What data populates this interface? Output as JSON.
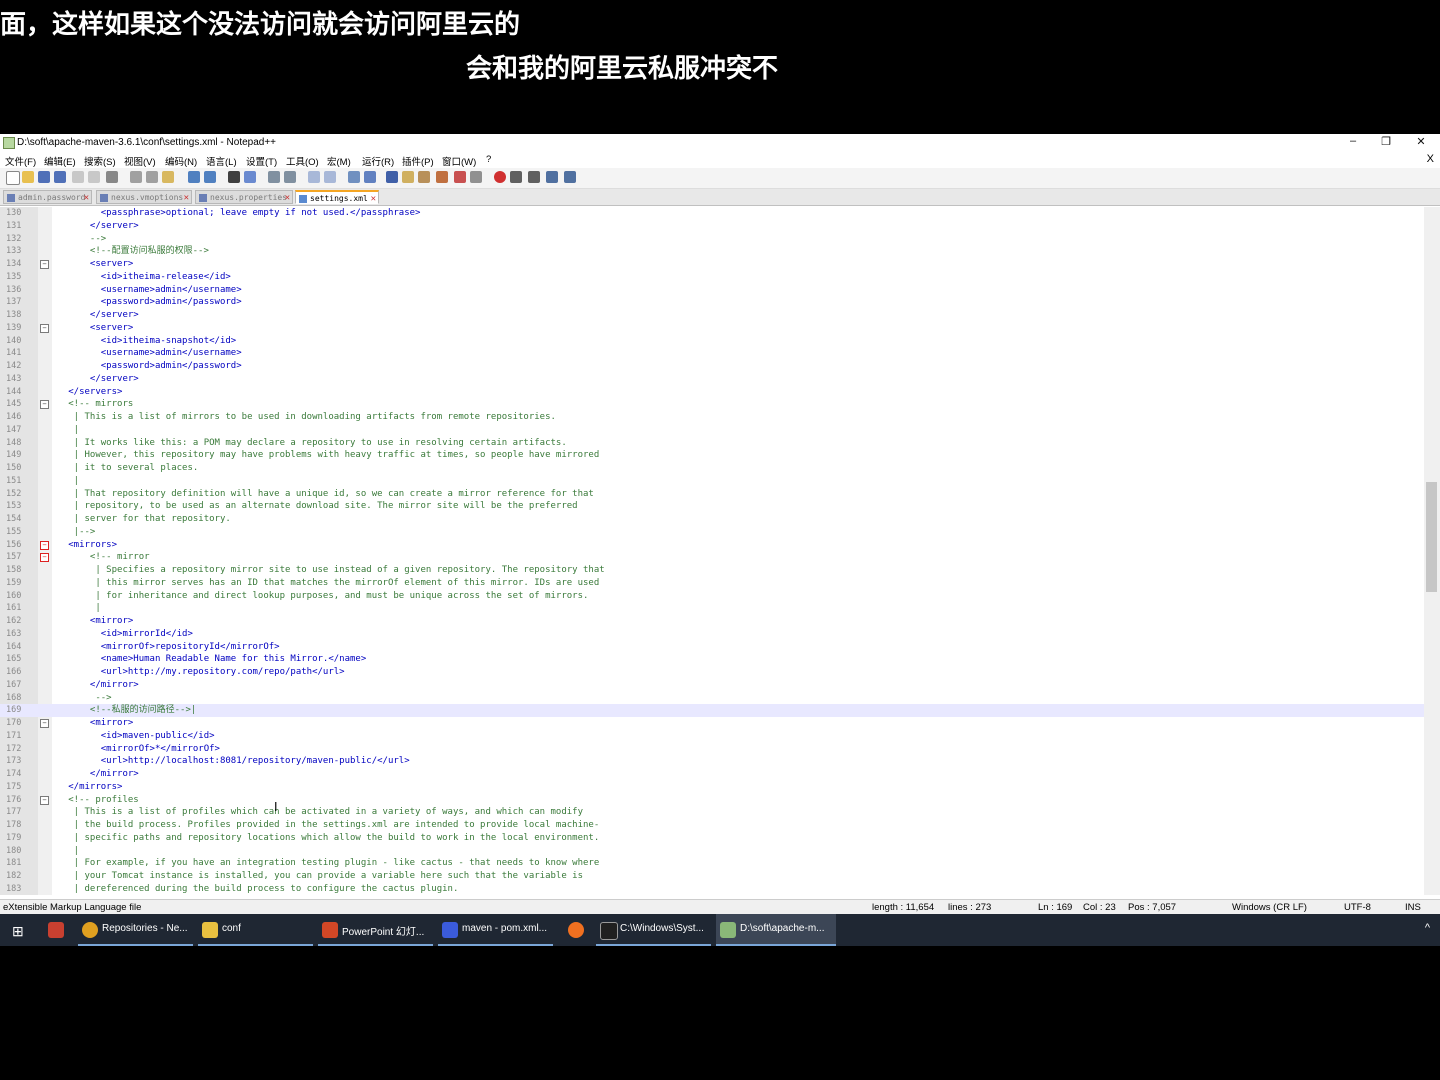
{
  "subtitles": {
    "line1": "面，这样如果这个没法访问就会访问阿里云的",
    "line2": "会和我的阿里云私服冲突不"
  },
  "window": {
    "title": "D:\\soft\\apache-maven-3.6.1\\conf\\settings.xml - Notepad++",
    "controls": {
      "minimize": "–",
      "maximize": "❐",
      "close": "✕"
    }
  },
  "menu": {
    "items": [
      "文件(F)",
      "编辑(E)",
      "搜索(S)",
      "视图(V)",
      "编码(N)",
      "语言(L)",
      "设置(T)",
      "工具(O)",
      "宏(M)",
      "运行(R)",
      "插件(P)",
      "窗口(W)",
      "?"
    ],
    "close": "X"
  },
  "tabs": [
    {
      "label": "admin.password",
      "active": false
    },
    {
      "label": "nexus.vmoptions",
      "active": false
    },
    {
      "label": "nexus.properties",
      "active": false
    },
    {
      "label": "settings.xml",
      "active": true
    }
  ],
  "editor": {
    "current_line": "169",
    "lines": [
      {
        "n": "130",
        "t": "         <passphrase>optional; leave empty if not used.</passphrase>"
      },
      {
        "n": "131",
        "t": "       </server>"
      },
      {
        "n": "132",
        "t": "       -->"
      },
      {
        "n": "133",
        "t": "       <!--配置访问私服的权限-->"
      },
      {
        "n": "134",
        "t": "       <server>",
        "f": "box"
      },
      {
        "n": "135",
        "t": "         <id>itheima-release</id>"
      },
      {
        "n": "136",
        "t": "         <username>admin</username>"
      },
      {
        "n": "137",
        "t": "         <password>admin</password>"
      },
      {
        "n": "138",
        "t": "       </server>"
      },
      {
        "n": "139",
        "t": "       <server>",
        "f": "box"
      },
      {
        "n": "140",
        "t": "         <id>itheima-snapshot</id>"
      },
      {
        "n": "141",
        "t": "         <username>admin</username>"
      },
      {
        "n": "142",
        "t": "         <password>admin</password>"
      },
      {
        "n": "143",
        "t": "       </server>"
      },
      {
        "n": "144",
        "t": "   </servers>"
      },
      {
        "n": "145",
        "t": "   <!-- mirrors",
        "f": "box"
      },
      {
        "n": "146",
        "t": "    | This is a list of mirrors to be used in downloading artifacts from remote repositories."
      },
      {
        "n": "147",
        "t": "    |"
      },
      {
        "n": "148",
        "t": "    | It works like this: a POM may declare a repository to use in resolving certain artifacts."
      },
      {
        "n": "149",
        "t": "    | However, this repository may have problems with heavy traffic at times, so people have mirrored"
      },
      {
        "n": "150",
        "t": "    | it to several places."
      },
      {
        "n": "151",
        "t": "    |"
      },
      {
        "n": "152",
        "t": "    | That repository definition will have a unique id, so we can create a mirror reference for that"
      },
      {
        "n": "153",
        "t": "    | repository, to be used as an alternate download site. The mirror site will be the preferred"
      },
      {
        "n": "154",
        "t": "    | server for that repository."
      },
      {
        "n": "155",
        "t": "    |-->"
      },
      {
        "n": "156",
        "t": "   <mirrors>",
        "f": "red"
      },
      {
        "n": "157",
        "t": "       <!-- mirror",
        "f": "red"
      },
      {
        "n": "158",
        "t": "        | Specifies a repository mirror site to use instead of a given repository. The repository that"
      },
      {
        "n": "159",
        "t": "        | this mirror serves has an ID that matches the mirrorOf element of this mirror. IDs are used"
      },
      {
        "n": "160",
        "t": "        | for inheritance and direct lookup purposes, and must be unique across the set of mirrors."
      },
      {
        "n": "161",
        "t": "        |"
      },
      {
        "n": "162",
        "t": "       <mirror>"
      },
      {
        "n": "163",
        "t": "         <id>mirrorId</id>"
      },
      {
        "n": "164",
        "t": "         <mirrorOf>repositoryId</mirrorOf>"
      },
      {
        "n": "165",
        "t": "         <name>Human Readable Name for this Mirror.</name>"
      },
      {
        "n": "166",
        "t": "         <url>http://my.repository.com/repo/path</url>"
      },
      {
        "n": "167",
        "t": "       </mirror>"
      },
      {
        "n": "168",
        "t": "        -->"
      },
      {
        "n": "169",
        "t": "       <!--私服的访问路径-->|"
      },
      {
        "n": "170",
        "t": "       <mirror>",
        "f": "box"
      },
      {
        "n": "171",
        "t": "         <id>maven-public</id>"
      },
      {
        "n": "172",
        "t": "         <mirrorOf>*</mirrorOf>"
      },
      {
        "n": "173",
        "t": "         <url>http://localhost:8081/repository/maven-public/</url>"
      },
      {
        "n": "174",
        "t": "       </mirror>"
      },
      {
        "n": "175",
        "t": "   </mirrors>"
      },
      {
        "n": "176",
        "t": "   <!-- profiles",
        "f": "box"
      },
      {
        "n": "177",
        "t": "    | This is a list of profiles which can be activated in a variety of ways, and which can modify"
      },
      {
        "n": "178",
        "t": "    | the build process. Profiles provided in the settings.xml are intended to provide local machine-"
      },
      {
        "n": "179",
        "t": "    | specific paths and repository locations which allow the build to work in the local environment."
      },
      {
        "n": "180",
        "t": "    |"
      },
      {
        "n": "181",
        "t": "    | For example, if you have an integration testing plugin - like cactus - that needs to know where"
      },
      {
        "n": "182",
        "t": "    | your Tomcat instance is installed, you can provide a variable here such that the variable is"
      },
      {
        "n": "183",
        "t": "    | dereferenced during the build process to configure the cactus plugin."
      }
    ]
  },
  "status": {
    "file_type": "eXtensible Markup Language file",
    "length": "length : 11,654",
    "lines": "lines : 273",
    "ln": "Ln : 169",
    "col": "Col : 23",
    "pos": "Pos : 7,057",
    "eol": "Windows (CR LF)",
    "encoding": "UTF-8",
    "mode": "INS"
  },
  "taskbar": {
    "items": [
      {
        "label": "Repositories - Ne...",
        "color": "#e0a020"
      },
      {
        "label": "conf",
        "color": "#e8c040"
      },
      {
        "label": "PowerPoint 幻灯...",
        "color": "#d24726"
      },
      {
        "label": "maven - pom.xml...",
        "color": "#3b5bdb"
      },
      {
        "label": "",
        "color": "#f07020"
      },
      {
        "label": "C:\\Windows\\Syst...",
        "color": "#202020"
      },
      {
        "label": "D:\\soft\\apache-m...",
        "color": "#8ab878"
      }
    ]
  }
}
